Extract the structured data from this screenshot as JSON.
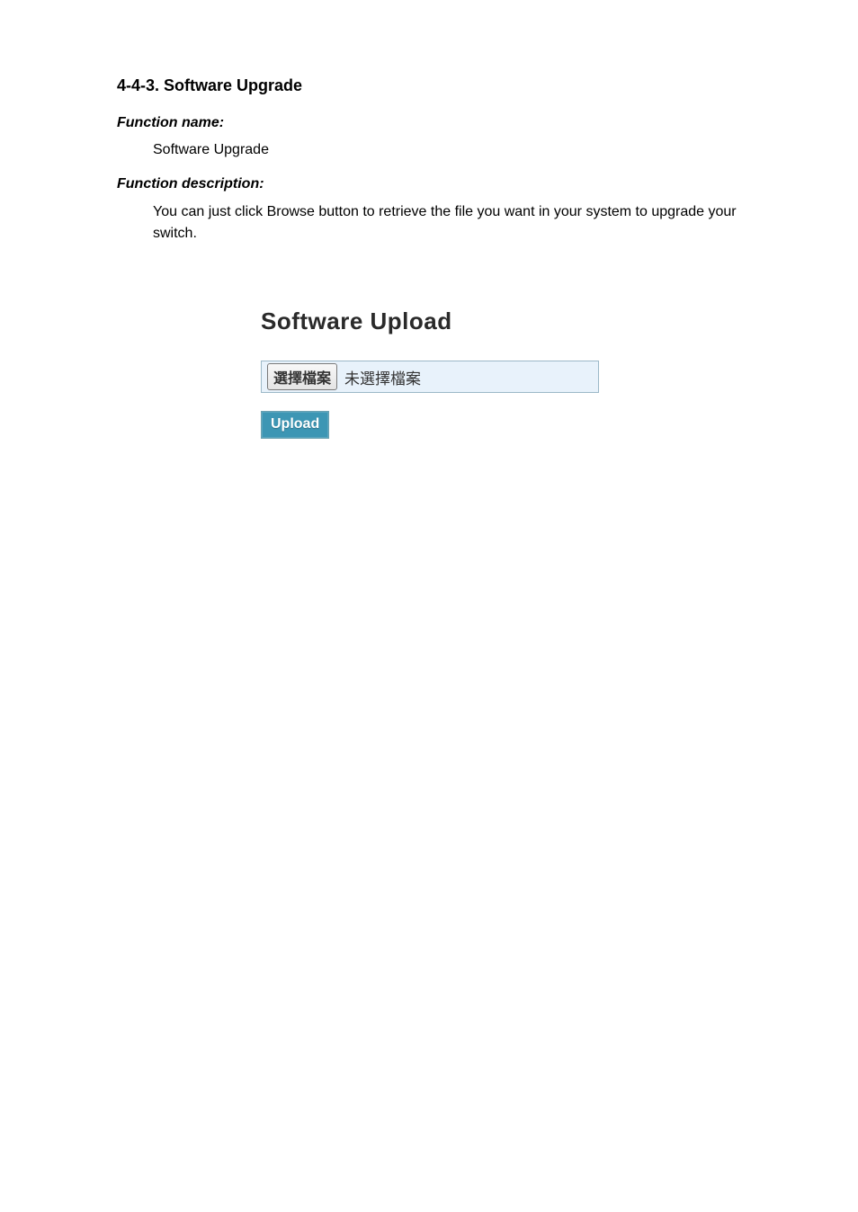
{
  "doc": {
    "section_title": "4-4-3. Software Upgrade",
    "fn_name_label": "Function name:",
    "fn_name_value": "Software Upgrade",
    "fn_desc_label": "Function description:",
    "fn_desc_value": "You can just click Browse button to retrieve the file you want in your system to upgrade your switch."
  },
  "upload_ui": {
    "title": "Software Upload",
    "choose_button_label": "選擇檔案",
    "no_file_text": "未選擇檔案",
    "upload_button_label": "Upload"
  }
}
